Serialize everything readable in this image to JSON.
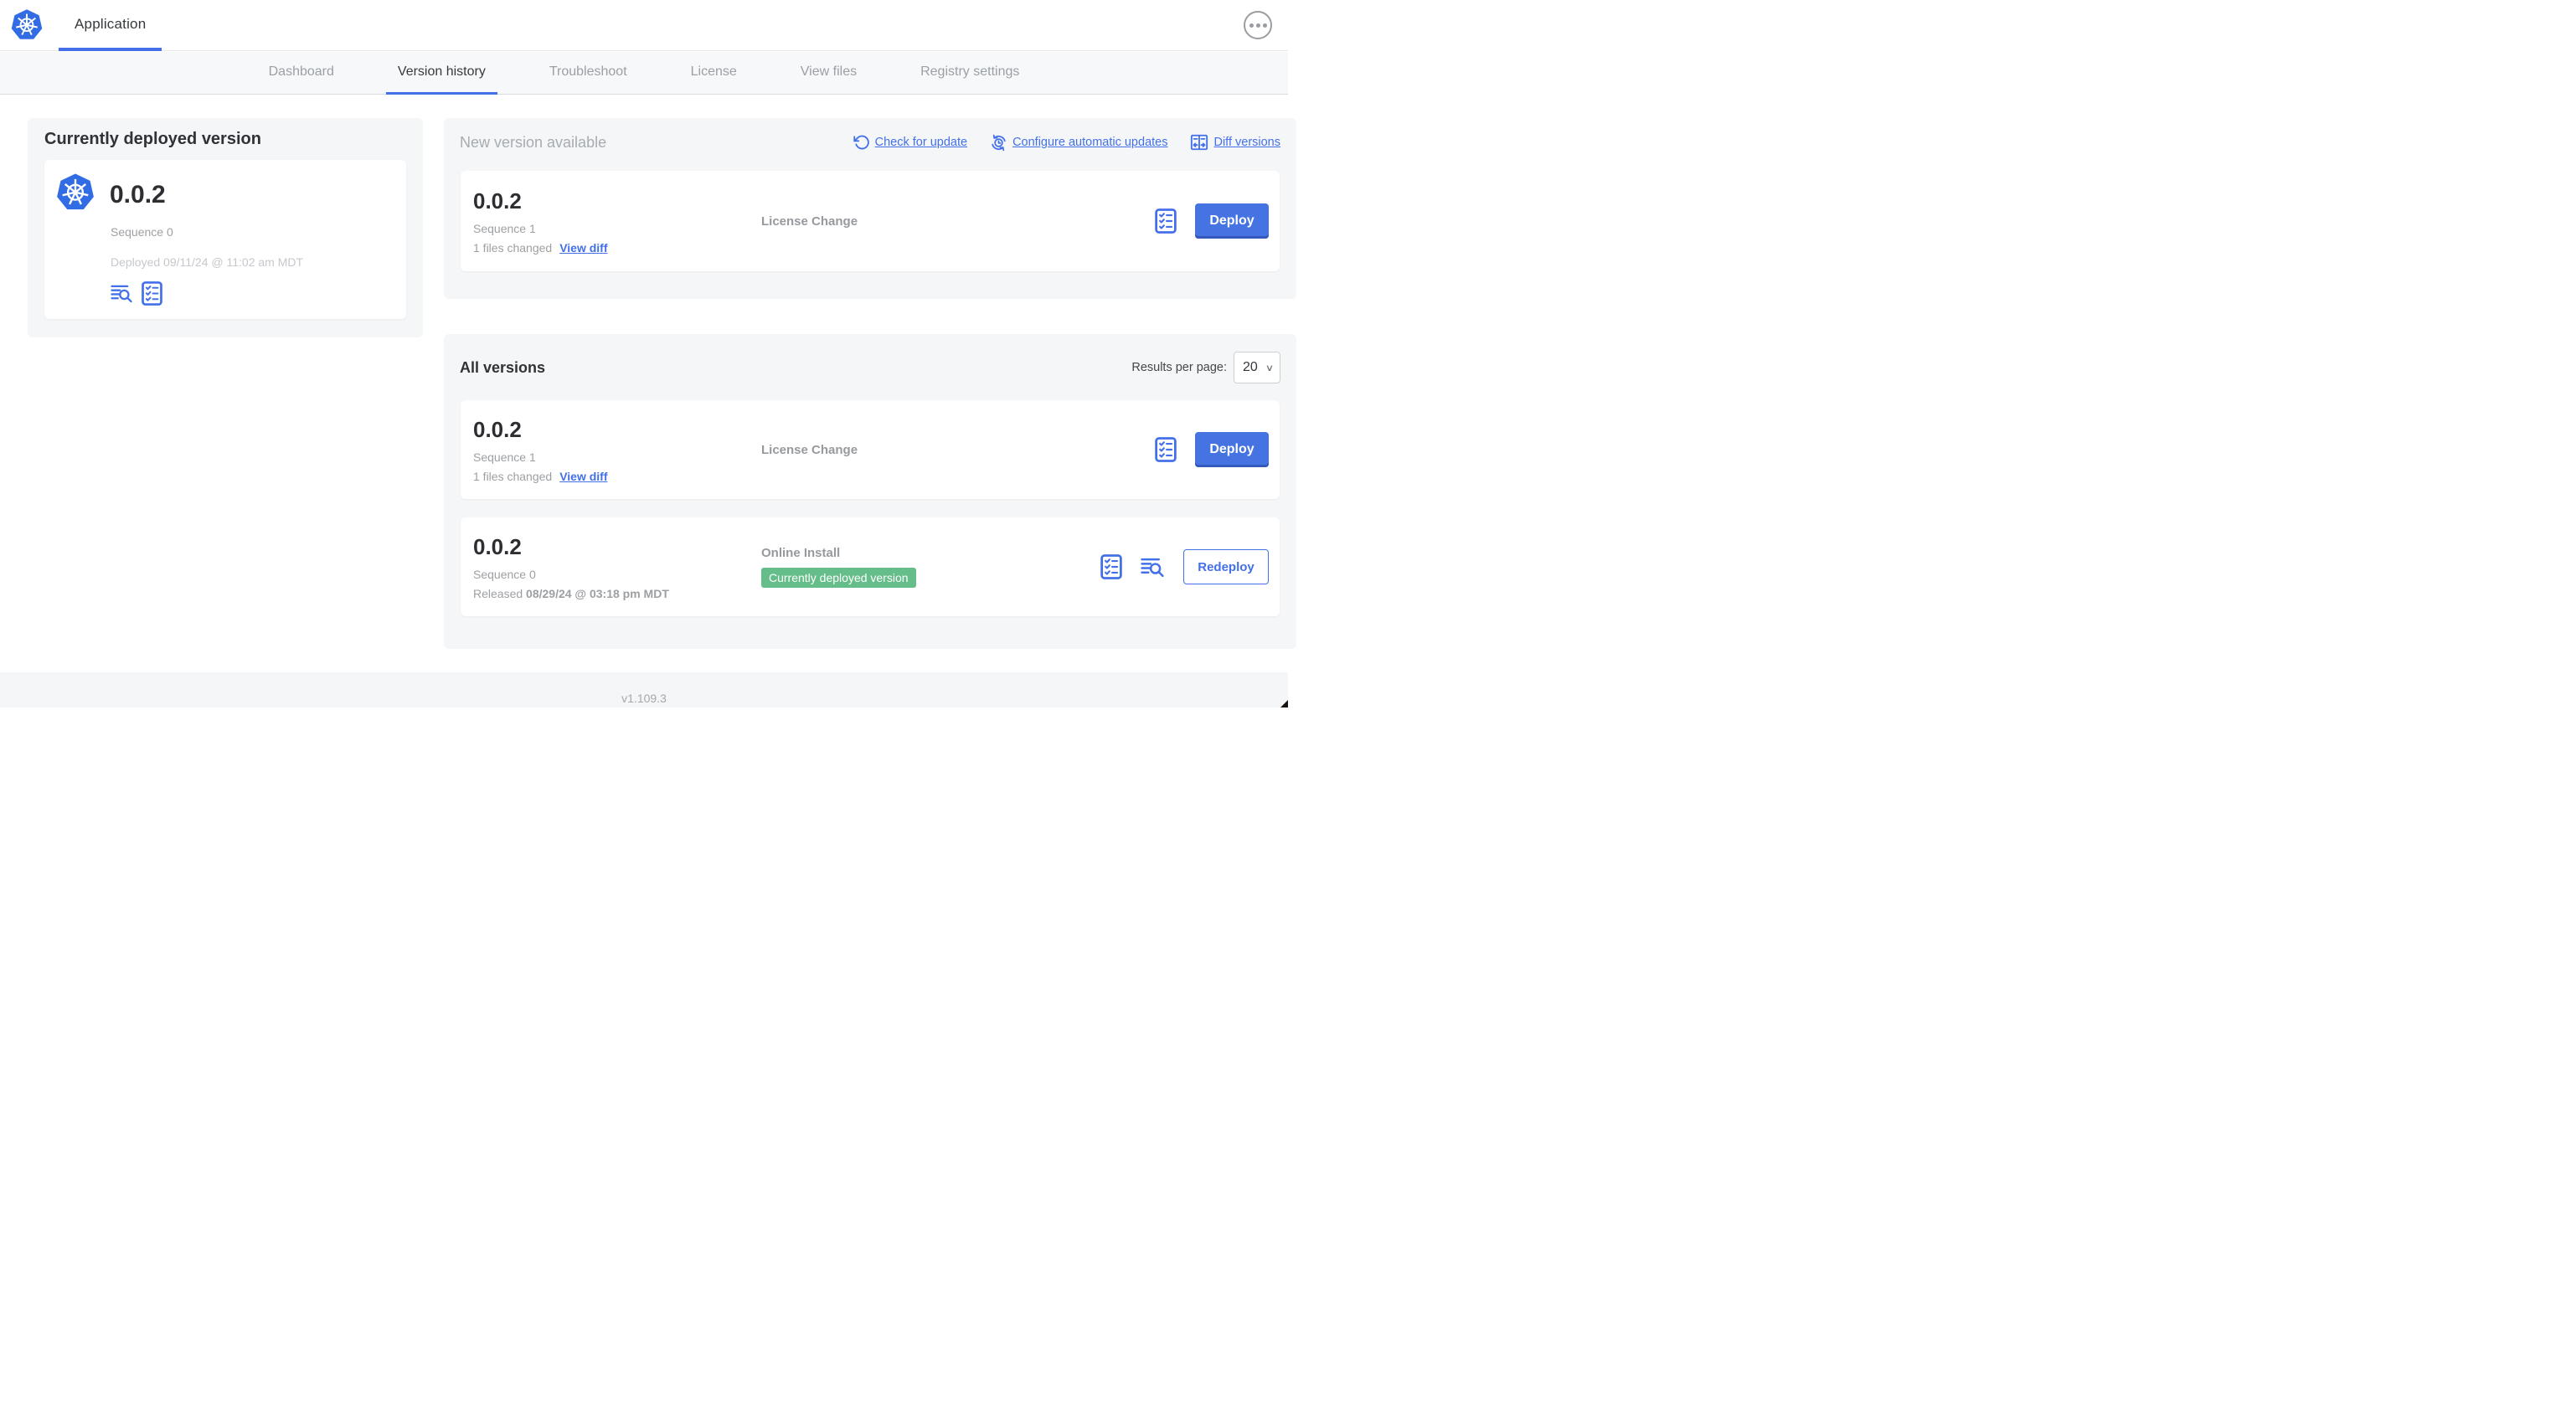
{
  "header": {
    "app_title": "Application"
  },
  "nav": {
    "tabs": [
      {
        "label": "Dashboard"
      },
      {
        "label": "Version history"
      },
      {
        "label": "Troubleshoot"
      },
      {
        "label": "License"
      },
      {
        "label": "View files"
      },
      {
        "label": "Registry settings"
      }
    ]
  },
  "current": {
    "title": "Currently deployed version",
    "version": "0.0.2",
    "sequence": "Sequence 0",
    "deployed": "Deployed 09/11/24 @ 11:02 am MDT"
  },
  "new_version": {
    "title": "New version available",
    "check_for_update": "Check for update",
    "configure_updates": "Configure automatic updates",
    "diff_versions": "Diff versions",
    "row": {
      "version": "0.0.2",
      "sequence": "Sequence 1",
      "files_changed": "1 files changed",
      "view_diff": "View diff",
      "source": "License Change",
      "deploy": "Deploy"
    }
  },
  "all_versions": {
    "title": "All versions",
    "results_label": "Results per page:",
    "results_value": "20",
    "rows": [
      {
        "version": "0.0.2",
        "sequence": "Sequence 1",
        "files_changed": "1 files changed",
        "view_diff": "View diff",
        "source": "License Change",
        "deploy": "Deploy"
      },
      {
        "version": "0.0.2",
        "sequence": "Sequence 0",
        "released_prefix": "Released",
        "released_date": "08/29/24 @ 03:18 pm MDT",
        "source": "Online Install",
        "badge": "Currently deployed version",
        "redeploy": "Redeploy"
      }
    ]
  },
  "footer": {
    "app_version": "v1.109.3"
  },
  "colors": {
    "accent": "#4370e8",
    "k8s_blue": "#326ce5",
    "badge_green": "#65be89"
  }
}
